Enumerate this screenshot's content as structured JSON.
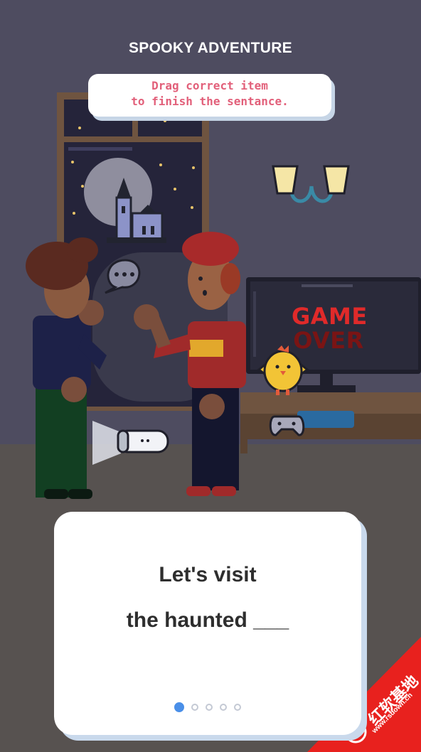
{
  "header": {
    "title": "SPOOKY ADVENTURE"
  },
  "instruction": {
    "line1": "Drag correct item",
    "line2": "to finish the sentance."
  },
  "scene": {
    "tv_text_line1": "GAME",
    "tv_text_line2": "OVER",
    "items": [
      "castle-icon",
      "speech-bubble-icon",
      "wall-lamp-icon",
      "chick-icon",
      "gamepad-icon",
      "flashlight-icon"
    ]
  },
  "sentence": {
    "line1": "Let's visit",
    "line2": "the haunted ___"
  },
  "pagination": {
    "total": 5,
    "current": 1
  },
  "watermark": {
    "text": "红软基地",
    "url": "www.rsdown.cn",
    "color": "#e8211e"
  },
  "colors": {
    "wall": "#4e4c60",
    "floor": "#575250",
    "instruction_text": "#e2607a",
    "pagination_active": "#4a8fe8",
    "tv_text": "#e02a2a"
  }
}
